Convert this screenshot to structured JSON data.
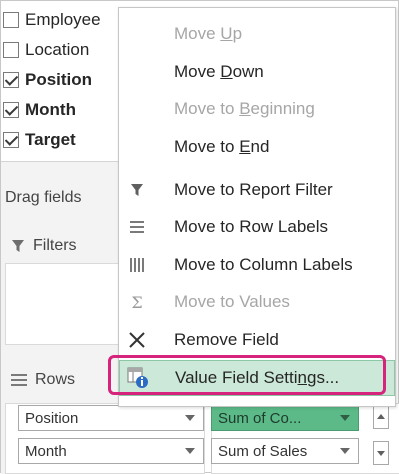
{
  "fields": [
    {
      "label": "Employee",
      "checked": false,
      "bold": false
    },
    {
      "label": "Location",
      "checked": false,
      "bold": false
    },
    {
      "label": "Position",
      "checked": true,
      "bold": true
    },
    {
      "label": "Month",
      "checked": true,
      "bold": true
    },
    {
      "label": "Target",
      "checked": true,
      "bold": true
    }
  ],
  "drag_fields_text": "Drag fields",
  "filters_label": "Filters",
  "rows_label": "Rows",
  "rows_items": [
    "Position",
    "Month"
  ],
  "values_items": [
    "Sum of Co...",
    "Sum of Sales"
  ],
  "menu": {
    "move_up": {
      "before": "Move ",
      "key": "U",
      "after": "p"
    },
    "move_down": {
      "before": "Move ",
      "key": "D",
      "after": "own"
    },
    "move_to_beginning": {
      "before": "Move to ",
      "key": "B",
      "after": "eginning"
    },
    "move_to_end": {
      "before": "Move to ",
      "key": "E",
      "after": "nd"
    },
    "move_to_report_filter": "Move to Report Filter",
    "move_to_row_labels": "Move to Row Labels",
    "move_to_column_labels": "Move to Column Labels",
    "move_to_values": "Move to Values",
    "remove_field": "Remove Field",
    "value_field_settings": {
      "before": "Value Field Setti",
      "key": "n",
      "after": "gs..."
    }
  },
  "colors": {
    "highlight_border": "#d6237b",
    "values_chip": "#5bba87",
    "hover_bg": "#cbe8d8"
  }
}
